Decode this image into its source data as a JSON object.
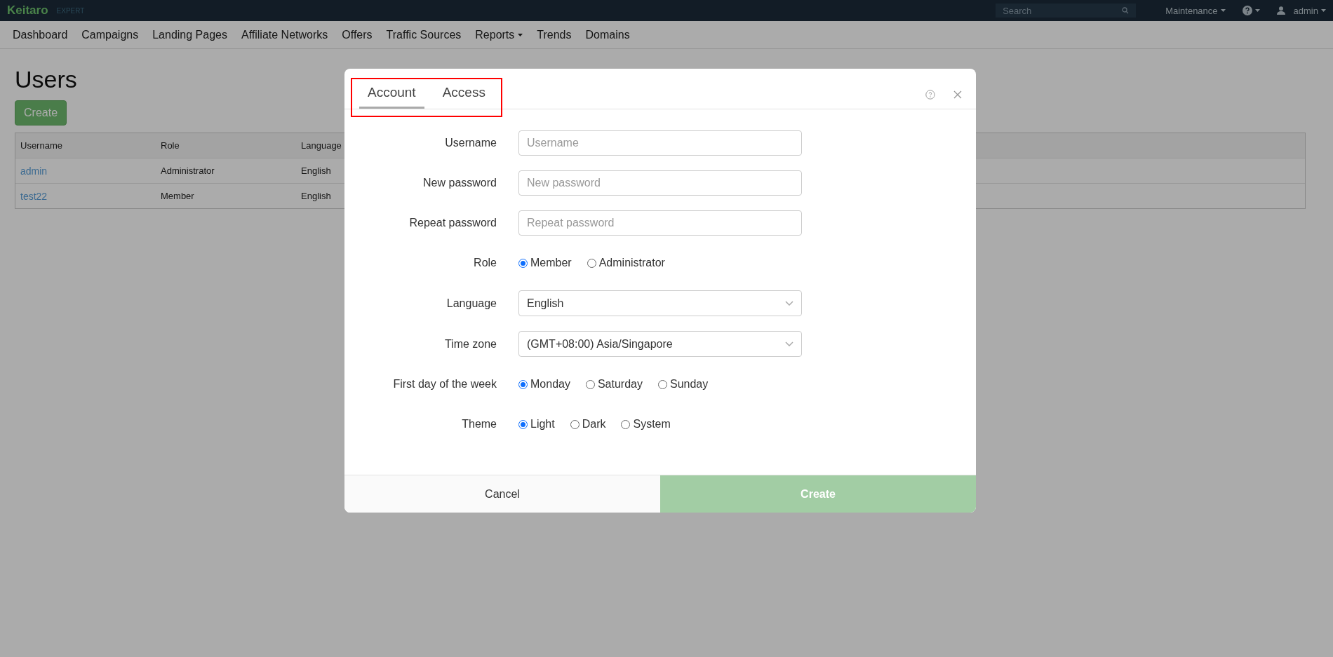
{
  "top_bar": {
    "logo": "Keitaro",
    "edition": "EXPERT",
    "search": {
      "placeholder": "Search"
    },
    "maintenance": "Maintenance",
    "user": "admin"
  },
  "nav": [
    {
      "label": "Dashboard",
      "dropdown": false
    },
    {
      "label": "Campaigns",
      "dropdown": false
    },
    {
      "label": "Landing Pages",
      "dropdown": false
    },
    {
      "label": "Affiliate Networks",
      "dropdown": false
    },
    {
      "label": "Offers",
      "dropdown": false
    },
    {
      "label": "Traffic Sources",
      "dropdown": false
    },
    {
      "label": "Reports",
      "dropdown": true
    },
    {
      "label": "Trends",
      "dropdown": false
    },
    {
      "label": "Domains",
      "dropdown": false
    }
  ],
  "page": {
    "title": "Users",
    "create_button": "Create",
    "table": {
      "columns": [
        "Username",
        "Role",
        "Language"
      ],
      "rows": [
        [
          "admin",
          "Administrator",
          "English"
        ],
        [
          "test22",
          "Member",
          "English"
        ]
      ]
    }
  },
  "dialog": {
    "tabs": [
      {
        "label": "Account",
        "selected": true
      },
      {
        "label": "Access",
        "selected": false
      }
    ],
    "fields": [
      {
        "kind": "text",
        "label": "Username",
        "placeholder": "Username"
      },
      {
        "kind": "text",
        "label": "New password",
        "placeholder": "New password"
      },
      {
        "kind": "text",
        "label": "Repeat password",
        "placeholder": "Repeat password"
      },
      {
        "kind": "radio",
        "label": "Role",
        "options": [
          {
            "label": "Member",
            "selected": true
          },
          {
            "label": "Administrator",
            "selected": false
          }
        ]
      },
      {
        "kind": "select",
        "label": "Language",
        "value": "English"
      },
      {
        "kind": "select",
        "label": "Time zone",
        "value": "(GMT+08:00) Asia/Singapore"
      },
      {
        "kind": "radio",
        "label": "First day of the week",
        "options": [
          {
            "label": "Monday",
            "selected": true
          },
          {
            "label": "Saturday",
            "selected": false
          },
          {
            "label": "Sunday",
            "selected": false
          }
        ]
      },
      {
        "kind": "radio",
        "label": "Theme",
        "options": [
          {
            "label": "Light",
            "selected": true
          },
          {
            "label": "Dark",
            "selected": false
          },
          {
            "label": "System",
            "selected": false
          }
        ]
      }
    ],
    "cancel": "Cancel",
    "submit": {
      "label": "Create",
      "disabled": true
    }
  }
}
